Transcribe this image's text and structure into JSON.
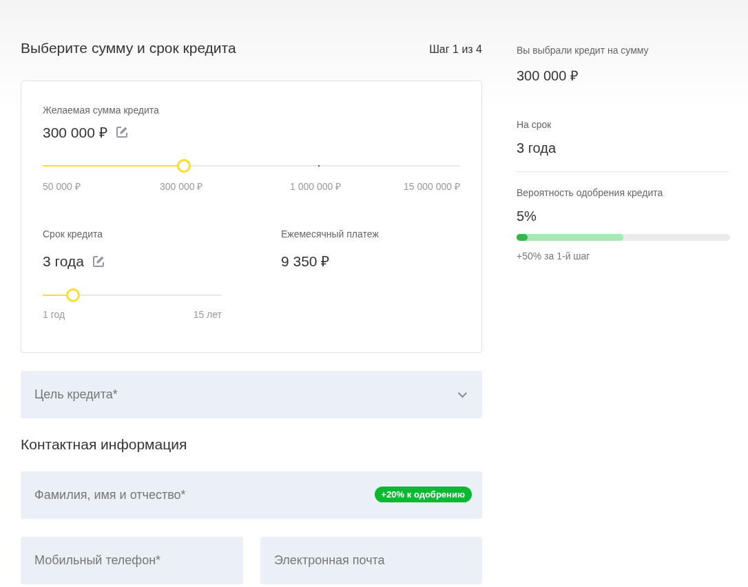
{
  "header": {
    "title": "Выберите сумму и срок кредита",
    "step": "Шаг 1 из 4"
  },
  "amount": {
    "label": "Желаемая сумма кредита",
    "value": "300 000 ₽",
    "level": 0.337,
    "ticks": [
      "50 000 ₽",
      "300 000 ₽",
      "1 000 000 ₽",
      "15 000 000 ₽"
    ]
  },
  "term": {
    "label": "Срок кредита",
    "value": "3 года",
    "level": 0.165,
    "ticks": [
      "1 год",
      "15 лет"
    ]
  },
  "payment": {
    "label": "Ежемесячный платеж",
    "value": "9 350 ₽"
  },
  "purpose": {
    "placeholder": "Цель кредита*",
    "expanded": false
  },
  "contact": {
    "title": "Контактная информация",
    "fields": [
      {
        "placeholder": "Фамилия, имя и отчество*",
        "badge": "+20% к одобрению"
      },
      {
        "placeholder": "Мобильный телефон*"
      },
      {
        "placeholder": "Электронная почта"
      }
    ]
  },
  "summary": {
    "amount_label": "Вы выбрали кредит на сумму",
    "amount": "300 000 ₽",
    "term_label": "На срок",
    "term": "3 года",
    "approval": {
      "label": "Вероятность одобрения кредита",
      "value": "5%",
      "level": 0.05,
      "bonus": {
        "level": 0.5,
        "text": "+50% за 1-й шаг"
      }
    }
  }
}
